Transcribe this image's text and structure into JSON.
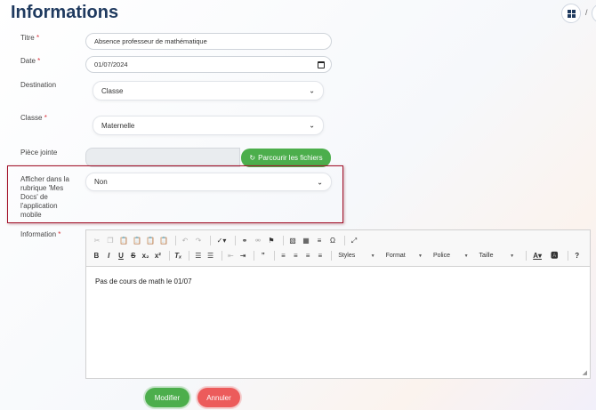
{
  "header": {
    "title": "Informations",
    "separator": "/"
  },
  "form": {
    "titre": {
      "label": "Titre",
      "required": "*",
      "value": "Absence professeur de mathématique"
    },
    "date": {
      "label": "Date",
      "required": "*",
      "value": "01/07/2024"
    },
    "destination": {
      "label": "Destination",
      "value": "Classe"
    },
    "classe": {
      "label": "Classe",
      "required": "*",
      "value": "Maternelle"
    },
    "piece_jointe": {
      "label": "Pièce jointe",
      "browse_label": "Parcourir les fichiers"
    },
    "mes_docs": {
      "label_lines": [
        "Afficher dans la",
        "rubrique 'Mes",
        "Docs' de",
        "l'application",
        "mobile"
      ],
      "value": "Non"
    },
    "information": {
      "label": "Information",
      "required": "*",
      "content": "Pas de cours de math le 01/07"
    }
  },
  "editor_toolbar": {
    "styles": "Styles",
    "format": "Format",
    "police": "Police",
    "taille": "Taille",
    "help": "?"
  },
  "actions": {
    "modifier": "Modifier",
    "annuler": "Annuler"
  },
  "colors": {
    "primary_green": "#4cae4c",
    "danger_red": "#ec5b5b",
    "title_navy": "#1f3a5f",
    "highlight": "#a3122a"
  }
}
